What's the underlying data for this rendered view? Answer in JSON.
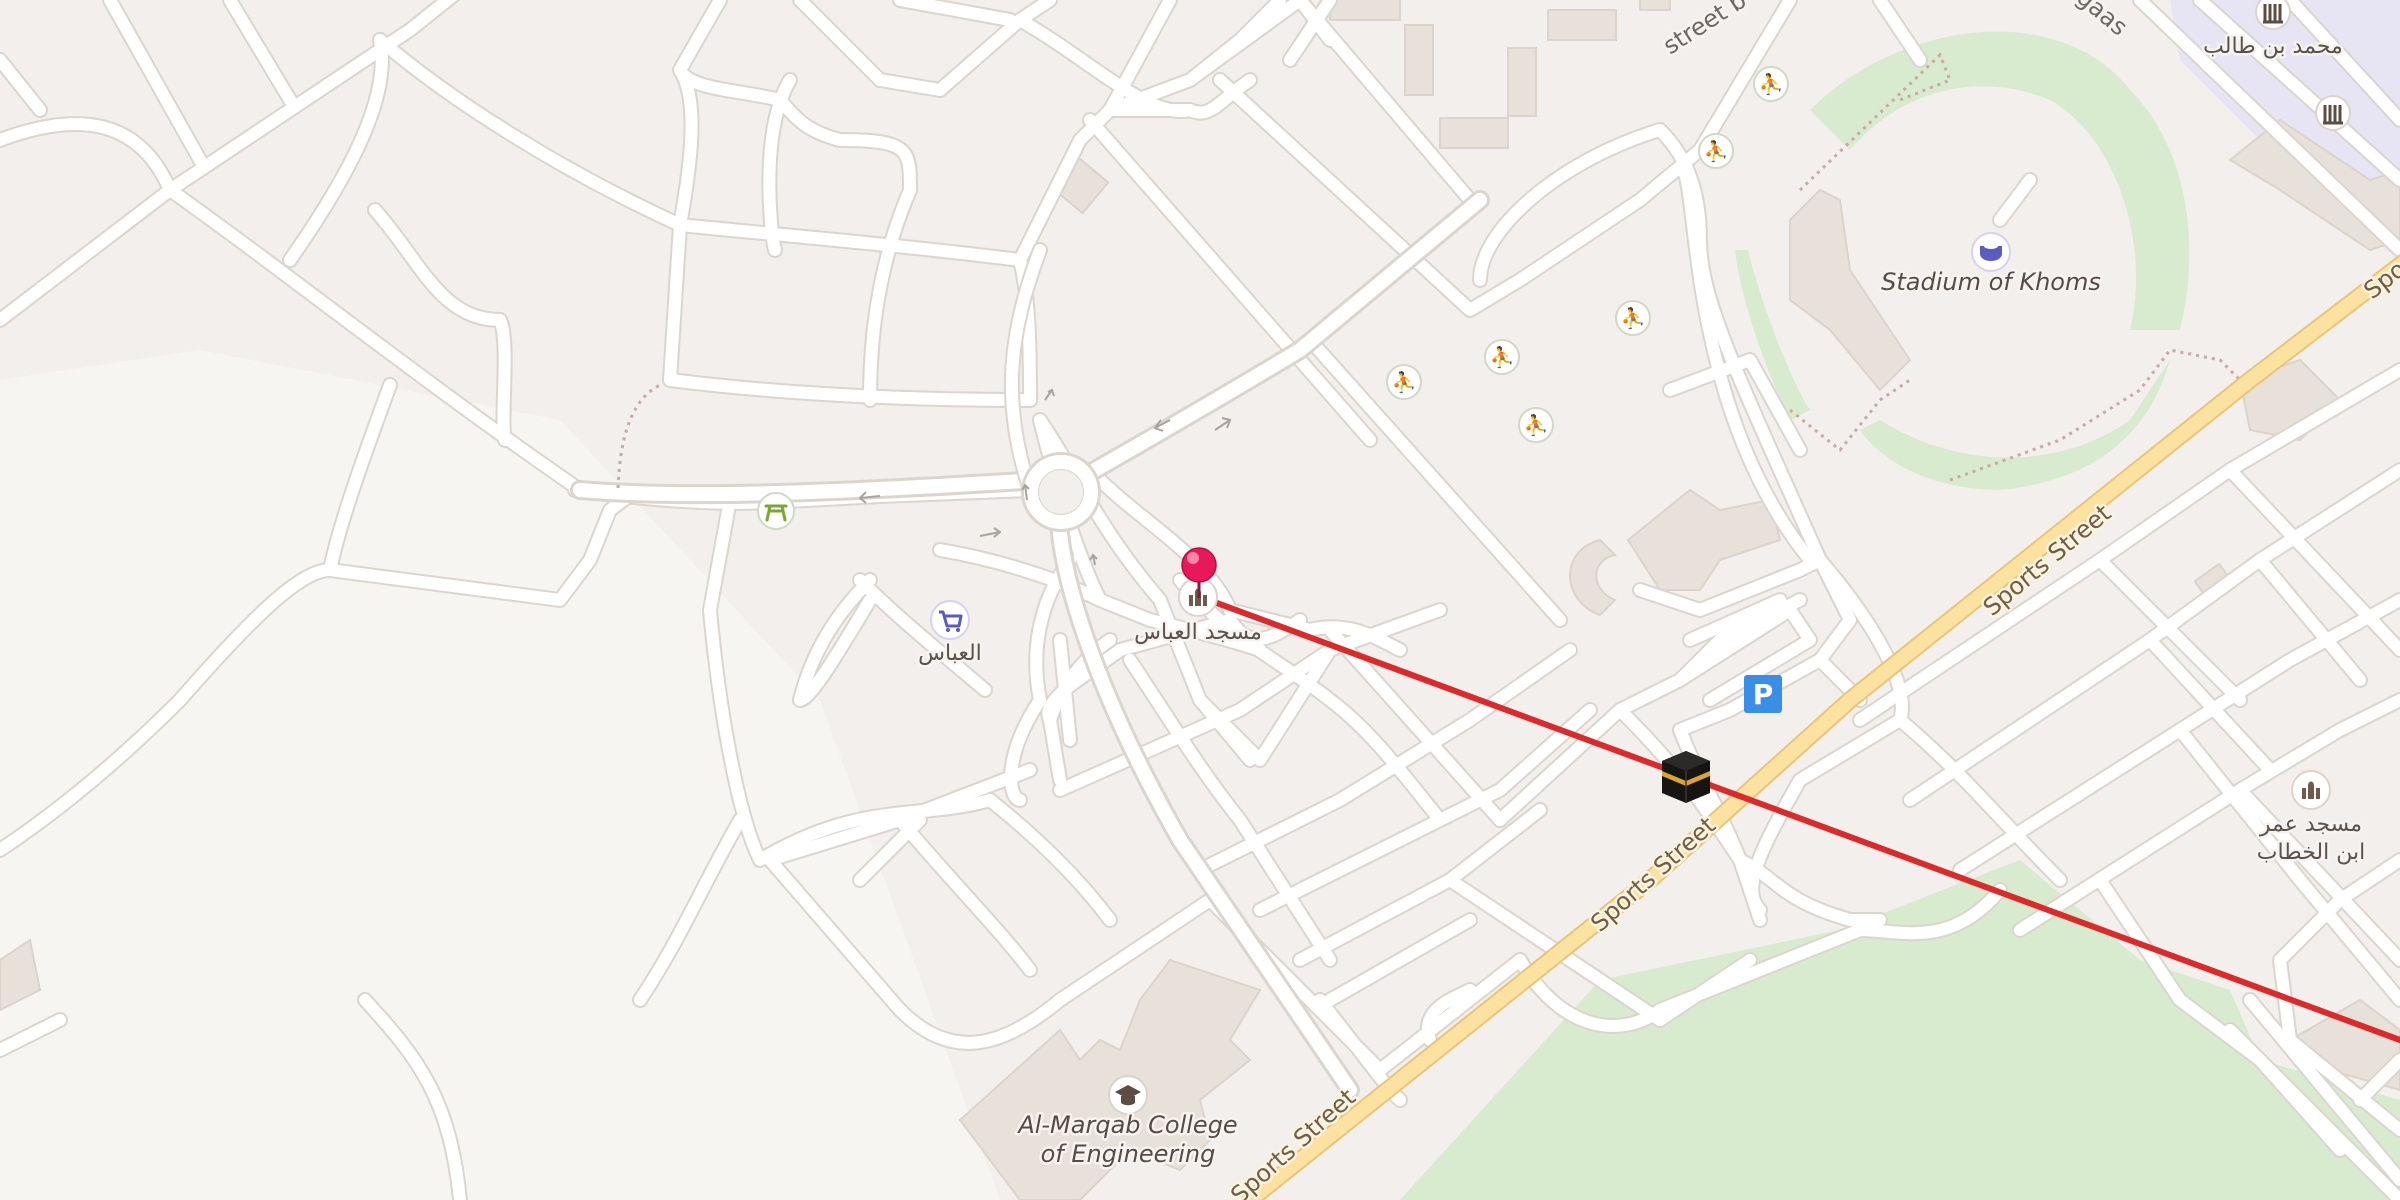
{
  "map": {
    "pois": {
      "mosque_abbas": "مسجد العباس",
      "shop_abbas": "العباس",
      "stadium": "Stadium of Khoms",
      "college_line1": "Al-Marqab College",
      "college_line2": "of Engineering",
      "mosque_omar_line1": "مسجد عمر",
      "mosque_omar_line2": "ابن الخطاب",
      "top_right": "محمد بن طالب"
    },
    "streets": {
      "sports_mid": "Sports Street",
      "sports_upper": "Sports Street",
      "sports_bottom": "Sports Street",
      "sports_right_edge": "Spo",
      "street_top": "street b",
      "top_right_fragment": "gaas"
    },
    "icons": {
      "pin": "selected-location-pin",
      "kaaba": "kaaba-qibla-marker",
      "parking": "P"
    },
    "colors": {
      "background": "#f2efec",
      "road": "#ffffff",
      "major_road": "#fbe2a0",
      "green": "#d8ebcf",
      "building": "#e8e1da",
      "qibla_line": "#dc2a2a",
      "pin": "#e8195a",
      "parking": "#3b8ee6",
      "sport_icon": "#76a934"
    }
  }
}
